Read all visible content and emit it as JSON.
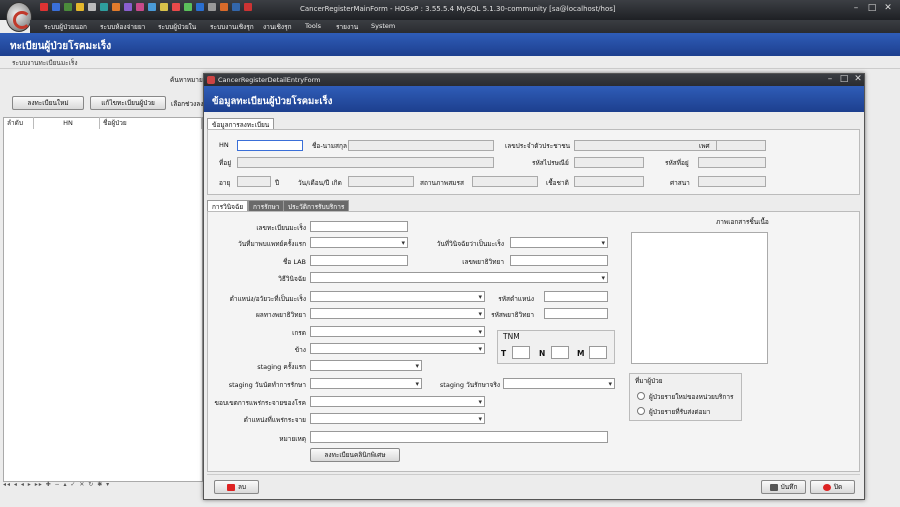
{
  "app": {
    "window_title": "CancerRegisterMainForm - HOSxP : 3.55.5.4 MySQL 5.1.30-community [sa@localhost/hos]",
    "menu": [
      "ระบบผู้ป่วยนอก",
      "ระบบห้องจ่ายยา",
      "ระบบผู้ป่วยใน",
      "ระบบงานเชิงรุก",
      "งานเชิงรุก",
      "Tools",
      "รายงาน",
      "System"
    ]
  },
  "main": {
    "header": "ทะเบียนผู้ป่วยโรคมะเร็ง",
    "subheader": "ระบบงานทะเบียนมะเร็ง",
    "search_label": "ค้นหาหมาย",
    "new_button": "ลงทะเบียนใหม่",
    "edit_button": "แก้ไขทะเบียนผู้ป่วย",
    "range_label": "เลือกช่วงลง",
    "columns": [
      "ลำดับ",
      "HN",
      "ชื่อผู้ป่วย"
    ]
  },
  "dialog": {
    "title": "CancerRegisterDetailEntryForm",
    "header": "ข้อมูลทะเบียนผู้ป่วยโรคมะเร็ง",
    "section_tab": "ข้อมูลการลงทะเบียน",
    "patient": {
      "hn": "HN",
      "name": "ชื่อ-นามสกุล",
      "cid": "เลขประจำตัวประชาชน",
      "sex": "เพศ",
      "address": "ที่อยู่",
      "postcode": "รหัสไปรษณีย์",
      "addr_code": "รหัสที่อยู่",
      "age": "อายุ",
      "year_unit": "ปี",
      "dob": "วัน/เดือน/ปี เกิด",
      "marital": "สถานภาพสมรส",
      "nation": "เชื้อชาติ",
      "religion": "ศาสนา"
    },
    "tabs": [
      "การวินิจฉัย",
      "การรักษา",
      "ประวัติการรับบริการ"
    ],
    "diag": {
      "reg_no": "เลขทะเบียนมะเร็ง",
      "first_visit": "วันที่มาพบแพทย์ครั้งแรก",
      "diag_date": "วันที่วินิจฉัยว่าเป็นมะเร็ง",
      "lab_name": "ชื่อ LAB",
      "path_no": "เลขพยาธิวิทยา",
      "method": "วิธีวินิจฉัย",
      "site": "ตำแหน่ง/อวัยวะที่เป็นมะเร็ง",
      "site_code": "รหัสตำแหน่ง",
      "pathology": "ผลทางพยาธิวิทยา",
      "path_code": "รหัสพยาธิวิทยา",
      "grade": "เกรด",
      "side": "ข้าง",
      "stage_first": "staging ครั้งแรก",
      "stage_treat_date": "staging วันนัดทำการรักษา",
      "stage_actual": "staging วันรักษาจริง",
      "extent": "ขอบเขตการแพร่กระจายของโรค",
      "metastasis": "ตำแหน่งที่แพร่กระจาย",
      "note": "หมายเหตุ",
      "clinic_button": "ลงทะเบียนคลินิกพิเศษ",
      "tnm": "TNM",
      "t": "T",
      "n": "N",
      "m": "M",
      "image_label": "ภาพเอกสารชิ้นเนื้อ",
      "origin_group": "ที่มาผู้ป่วย",
      "origin_new": "ผู้ป่วยรายใหม่ของหน่วยบริการ",
      "origin_refer": "ผู้ป่วยรายที่รับส่งต่อมา"
    },
    "delete_button": "ลบ",
    "save_button": "บันทึก",
    "close_button": "ปิด"
  }
}
